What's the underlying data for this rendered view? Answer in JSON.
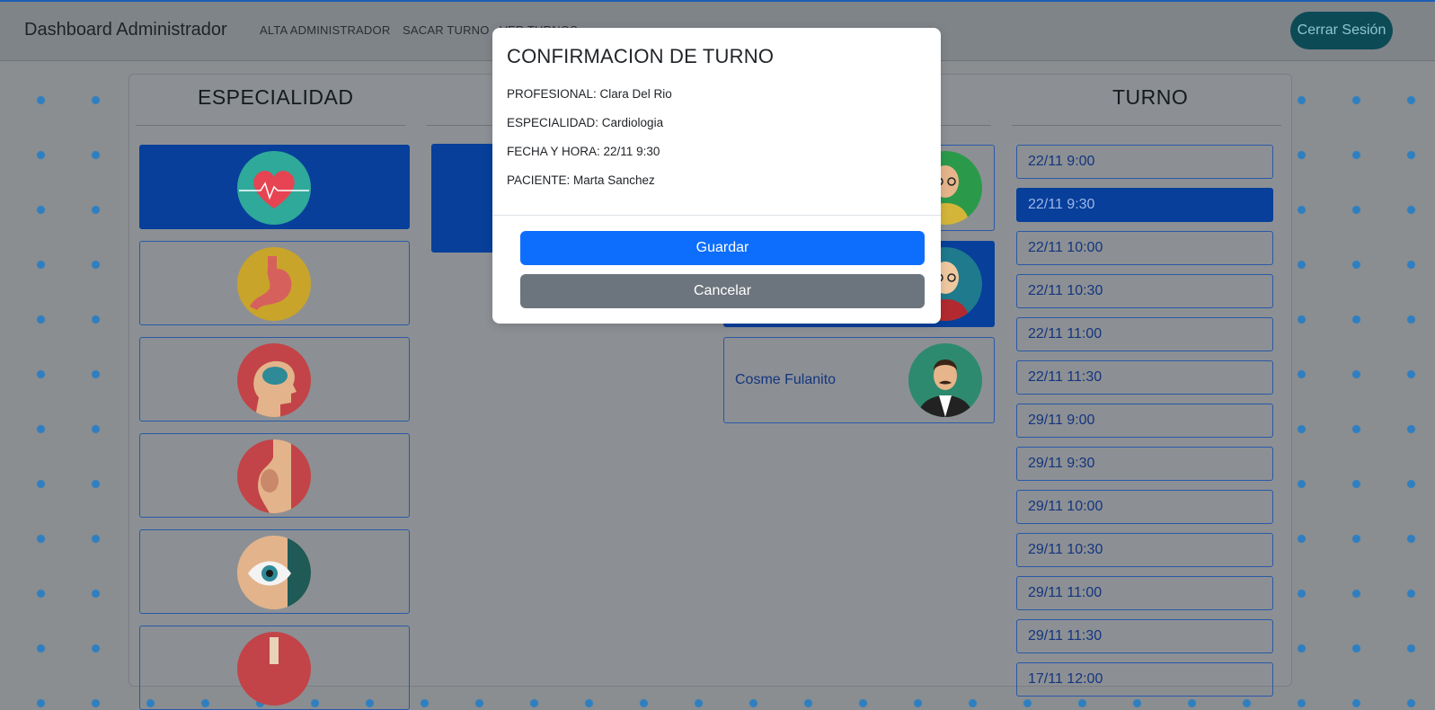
{
  "navbar": {
    "brand": "Dashboard Administrador",
    "links": [
      "ALTA ADMINISTRADOR",
      "SACAR TURNO",
      "VER TURNOS"
    ],
    "logout_label": "Cerrar Sesión"
  },
  "columns": {
    "especialidad_title": "ESPECIALIDAD",
    "turno_title": "TURNO"
  },
  "especialidades": [
    {
      "icon": "heart-icon",
      "selected": true
    },
    {
      "icon": "stomach-icon",
      "selected": false
    },
    {
      "icon": "brain-icon",
      "selected": false
    },
    {
      "icon": "pregnancy-icon",
      "selected": false
    },
    {
      "icon": "eye-icon",
      "selected": false
    },
    {
      "icon": "lungs-icon",
      "selected": false
    }
  ],
  "profesionales": [
    {
      "name": "",
      "avatar": "doctor-glasses-avatar",
      "selected": false
    },
    {
      "name": "",
      "avatar": "woman-glasses-avatar",
      "selected": true
    },
    {
      "name": "Cosme Fulanito",
      "avatar": "man-mustache-avatar",
      "selected": false
    }
  ],
  "turnos": [
    {
      "label": "22/11 9:00",
      "selected": false
    },
    {
      "label": "22/11 9:30",
      "selected": true
    },
    {
      "label": "22/11 10:00",
      "selected": false
    },
    {
      "label": "22/11 10:30",
      "selected": false
    },
    {
      "label": "22/11 11:00",
      "selected": false
    },
    {
      "label": "22/11 11:30",
      "selected": false
    },
    {
      "label": "29/11 9:00",
      "selected": false
    },
    {
      "label": "29/11 9:30",
      "selected": false
    },
    {
      "label": "29/11 10:00",
      "selected": false
    },
    {
      "label": "29/11 10:30",
      "selected": false
    },
    {
      "label": "29/11 11:00",
      "selected": false
    },
    {
      "label": "29/11 11:30",
      "selected": false
    },
    {
      "label": "17/11 12:00",
      "selected": false
    }
  ],
  "modal": {
    "title": "CONFIRMACION DE TURNO",
    "profesional": "PROFESIONAL: Clara Del Rio",
    "especialidad": "ESPECIALIDAD: Cardiologia",
    "fecha_hora": "FECHA Y HORA: 22/11 9:30",
    "paciente": "PACIENTE: Marta Sanchez",
    "save_label": "Guardar",
    "cancel_label": "Cancelar"
  },
  "colors": {
    "primary": "#0d6efd",
    "secondary": "#6c757d",
    "selected_card": "#073f9a",
    "logout": "#0c4a56"
  }
}
